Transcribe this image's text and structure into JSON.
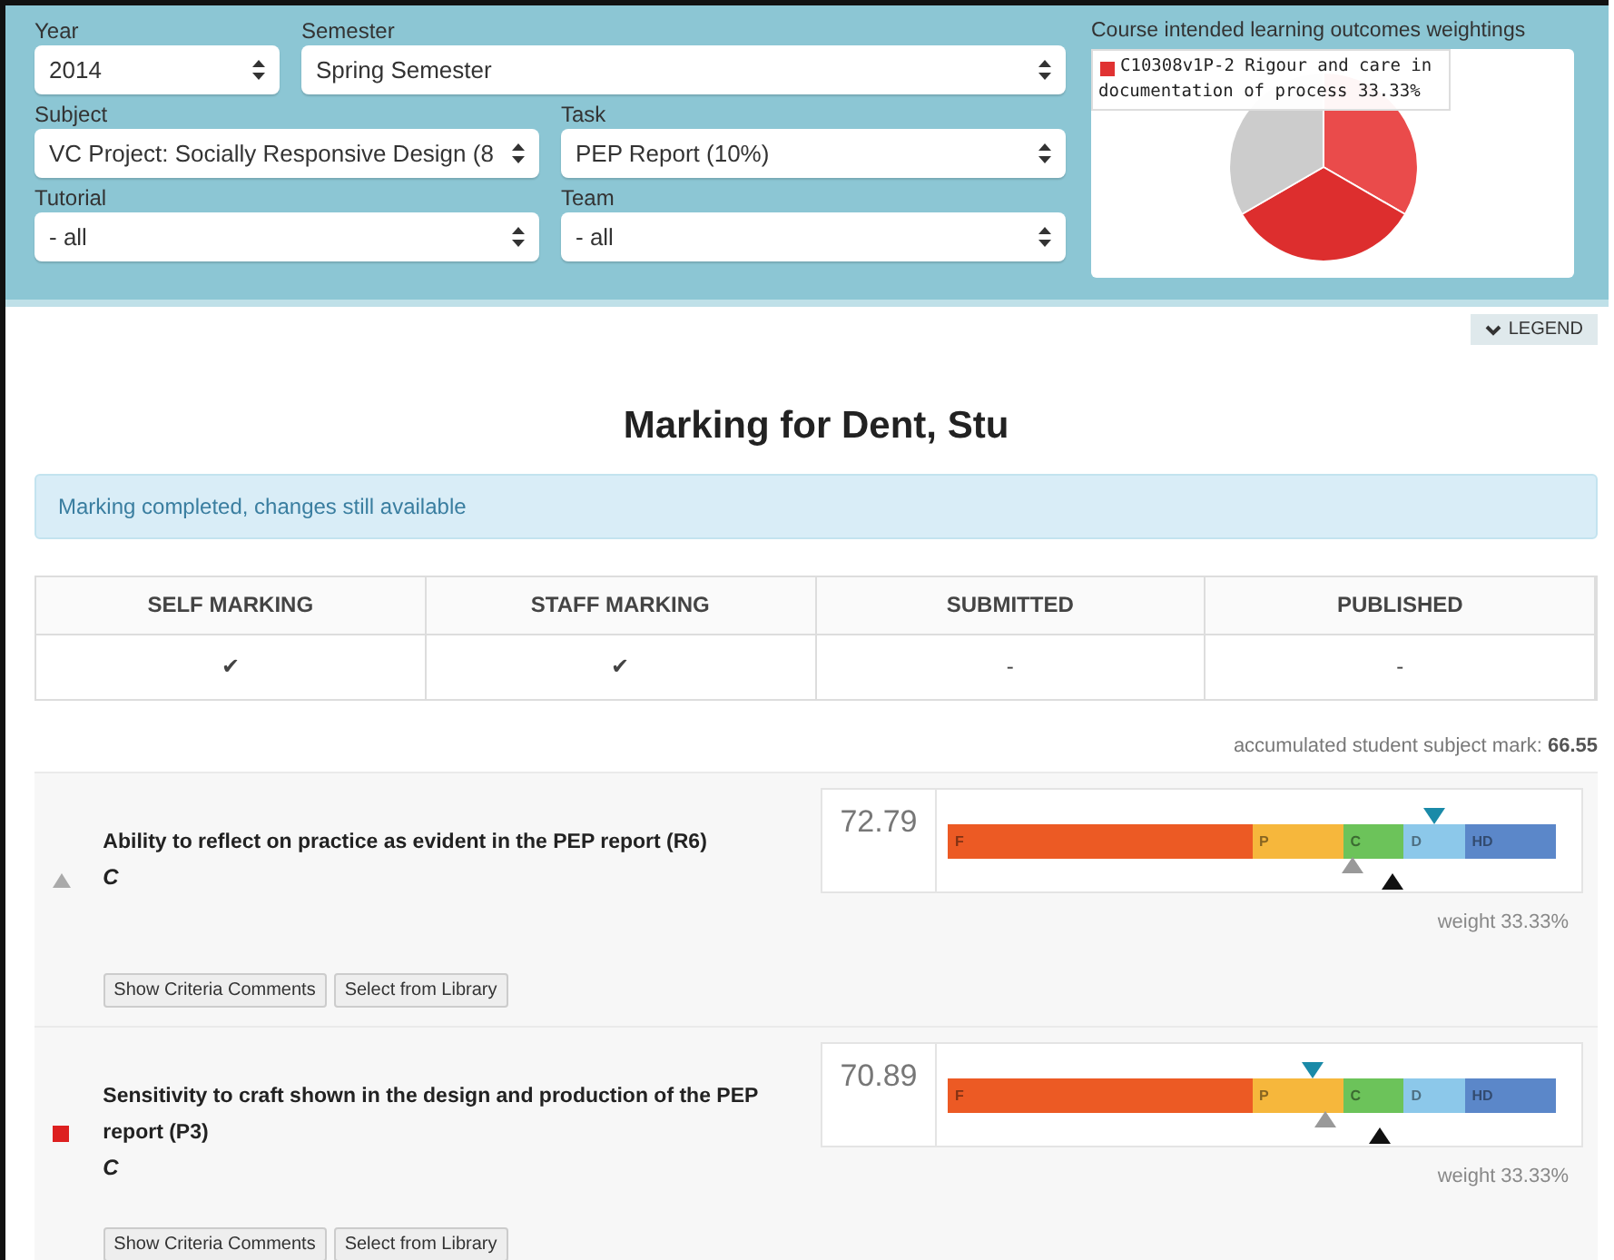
{
  "filters": [
    {
      "label": "Year",
      "value": "2014",
      "kind": "small"
    },
    {
      "label": "Semester",
      "value": "Spring Semester",
      "kind": "wide"
    },
    {
      "label": "Subject",
      "value": "VC Project: Socially Responsive Design (8",
      "kind": "half"
    },
    {
      "label": "Task",
      "value": "PEP Report (10%)",
      "kind": "half"
    },
    {
      "label": "Tutorial",
      "value": "- all",
      "kind": "half"
    },
    {
      "label": "Team",
      "value": "- all",
      "kind": "half"
    }
  ],
  "weightings": {
    "title": "Course intended learning outcomes weightings",
    "tooltip": "C10308v1P-2 Rigour and care in documentation of process 33.33%",
    "color": "#e03232"
  },
  "legend_button": "LEGEND",
  "heading": "Marking for Dent, Stu",
  "alert": "Marking completed, changes still available",
  "status_table": {
    "columns": [
      "SELF MARKING",
      "STAFF MARKING",
      "SUBMITTED",
      "PUBLISHED"
    ],
    "values": [
      "✔",
      "✔",
      "-",
      "-"
    ]
  },
  "accumulated": {
    "label": "accumulated student subject mark:",
    "value": "66.55"
  },
  "criteria": [
    {
      "title": "Ability to reflect on practice as evident in the PEP report (R6)",
      "grade": "C",
      "kind": "triangle",
      "score": "72.79",
      "weight": "weight 33.33%",
      "buttons": [
        "Show Criteria Comments",
        "Select from Library"
      ],
      "bands": [
        "F",
        "P",
        "C",
        "D",
        "HD"
      ],
      "markers": [
        {
          "kind": "down",
          "level": 0.8
        },
        {
          "kind": "grey",
          "level": 0.665
        },
        {
          "kind": "black",
          "level": 0.73
        }
      ]
    },
    {
      "title": "Sensitivity to craft shown in the design and production of the PEP report (P3)",
      "grade": "C",
      "kind": "square",
      "score": "70.89",
      "weight": "weight 33.33%",
      "buttons": [
        "Show Criteria Comments",
        "Select from Library"
      ],
      "bands": [
        "F",
        "P",
        "C",
        "D",
        "HD"
      ],
      "markers": [
        {
          "kind": "down",
          "level": 0.6
        },
        {
          "kind": "grey",
          "level": 0.62
        },
        {
          "kind": "black",
          "level": 0.71
        }
      ]
    }
  ]
}
